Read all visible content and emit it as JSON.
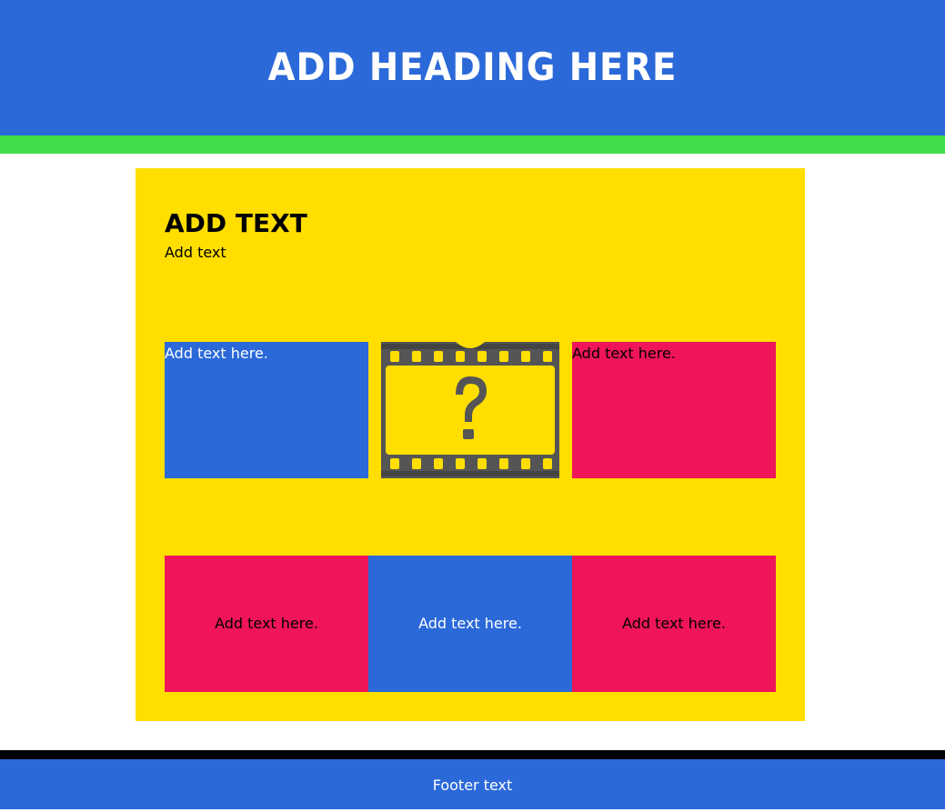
{
  "header": {
    "title": "Add Heading Here"
  },
  "panel": {
    "heading": "Add text",
    "text": "Add text",
    "row1": [
      {
        "label": "Add text here.",
        "color": "#2b69d9"
      },
      {
        "label": "",
        "image": "film-question-icon"
      },
      {
        "label": "Add text here.",
        "color": "#ef1558"
      }
    ],
    "row2": [
      {
        "label": "Add text here.",
        "color": "#ef1558"
      },
      {
        "label": "Add text here.",
        "color": "#2b69d9"
      },
      {
        "label": "Add text here.",
        "color": "#ef1558"
      }
    ]
  },
  "footer": {
    "text": "Footer text"
  },
  "colors": {
    "header": "#2b69d9",
    "accent_bar": "#43dc4a",
    "panel": "#ffde00",
    "pink": "#ef1558",
    "footer_bar": "#000000"
  }
}
